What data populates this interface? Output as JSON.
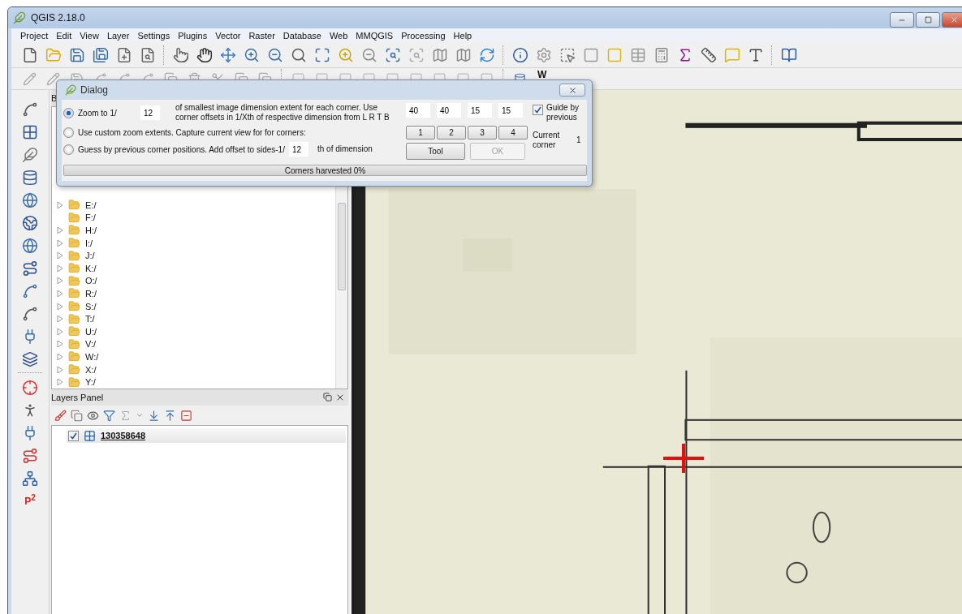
{
  "window": {
    "title": "QGIS 2.18.0"
  },
  "menu": [
    "Project",
    "Edit",
    "View",
    "Layer",
    "Settings",
    "Plugins",
    "Vector",
    "Raster",
    "Database",
    "Web",
    "MMQGIS",
    "Processing",
    "Help"
  ],
  "plugin_toolbar": {
    "label": "W"
  },
  "side_toolbar": {
    "plugin_label": "P$^{2}$"
  },
  "browser_panel": {
    "title": "B",
    "items": [
      {
        "label": "E:/",
        "expandable": true
      },
      {
        "label": "F:/",
        "expandable": false
      },
      {
        "label": "H:/",
        "expandable": true
      },
      {
        "label": "I:/",
        "expandable": true
      },
      {
        "label": "J:/",
        "expandable": true
      },
      {
        "label": "K:/",
        "expandable": true
      },
      {
        "label": "O:/",
        "expandable": true
      },
      {
        "label": "R:/",
        "expandable": true
      },
      {
        "label": "S:/",
        "expandable": true
      },
      {
        "label": "T:/",
        "expandable": true
      },
      {
        "label": "U:/",
        "expandable": true
      },
      {
        "label": "V:/",
        "expandable": true
      },
      {
        "label": "W:/",
        "expandable": true
      },
      {
        "label": "X:/",
        "expandable": true
      },
      {
        "label": "Y:/",
        "expandable": true
      }
    ]
  },
  "layers_panel": {
    "title": "Layers Panel",
    "layers": [
      {
        "name": "130358648",
        "checked": true,
        "selected": true
      }
    ]
  },
  "dialog": {
    "title": "Dialog",
    "modes": [
      {
        "label": "Zoom to 1/",
        "selected": true,
        "value": "12",
        "note": "of smallest image dimension extent for each corner. Use corner offsets in 1/Xth of respective dimension from L R T B"
      },
      {
        "label": "Use custom zoom extents. Capture current view for for corners:",
        "selected": false
      },
      {
        "label": "Guess by previous corner positions. Add offset to sides-1/",
        "selected": false,
        "value": "12",
        "note": "th of dimension"
      }
    ],
    "offsets": [
      "40",
      "40",
      "15",
      "15"
    ],
    "guide": {
      "label": "Guide by previous",
      "checked": true
    },
    "corner_buttons": [
      "1",
      "2",
      "3",
      "4"
    ],
    "tool_button": {
      "label": "Tool",
      "disabled": false
    },
    "ok_button": {
      "label": "OK",
      "disabled": true
    },
    "current_corner": {
      "label": "Current corner",
      "value": "1"
    },
    "progress": {
      "label": "Corners harvested 0%",
      "level": 0
    }
  }
}
